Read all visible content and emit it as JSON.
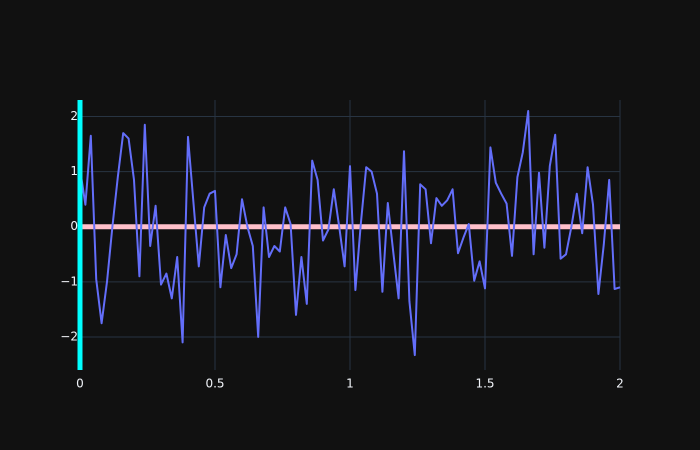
{
  "chart_data": {
    "type": "line",
    "title": "",
    "xlabel": "",
    "ylabel": "",
    "xlim": [
      0,
      2
    ],
    "ylim": [
      -2.6,
      2.3
    ],
    "grid": true,
    "x_ticks": [
      0,
      0.5,
      1,
      1.5,
      2
    ],
    "x_tick_labels": [
      "0",
      "0.5",
      "1",
      "1.5",
      "2"
    ],
    "y_ticks": [
      -2,
      -1,
      0,
      1,
      2
    ],
    "y_tick_labels": [
      "−2",
      "−1",
      "0",
      "1",
      "2"
    ],
    "series": [
      {
        "name": "",
        "color": "#636efa",
        "x": [
          0.0,
          0.02,
          0.04,
          0.06,
          0.08,
          0.1,
          0.12,
          0.14,
          0.16,
          0.18,
          0.2,
          0.22,
          0.24,
          0.26,
          0.28,
          0.3,
          0.32,
          0.34,
          0.36,
          0.38,
          0.4,
          0.42,
          0.44,
          0.46,
          0.48,
          0.5,
          0.52,
          0.54,
          0.56,
          0.58,
          0.6,
          0.62,
          0.64,
          0.66,
          0.68,
          0.7,
          0.72,
          0.74,
          0.76,
          0.78,
          0.8,
          0.82,
          0.84,
          0.86,
          0.88,
          0.9,
          0.92,
          0.94,
          0.96,
          0.98,
          1.0,
          1.02,
          1.04,
          1.06,
          1.08,
          1.1,
          1.12,
          1.14,
          1.16,
          1.18,
          1.2,
          1.22,
          1.24,
          1.26,
          1.28,
          1.3,
          1.32,
          1.34,
          1.36,
          1.38,
          1.4,
          1.42,
          1.44,
          1.46,
          1.48,
          1.5,
          1.52,
          1.54,
          1.56,
          1.58,
          1.6,
          1.62,
          1.64,
          1.66,
          1.68,
          1.7,
          1.72,
          1.74,
          1.76,
          1.78,
          1.8,
          1.82,
          1.84,
          1.86,
          1.88,
          1.9,
          1.92,
          1.94,
          1.96,
          1.98,
          2.0
        ],
        "y": [
          1.05,
          0.4,
          1.65,
          -0.95,
          -1.75,
          -1.0,
          0.0,
          0.9,
          1.7,
          1.6,
          0.85,
          -0.9,
          1.85,
          -0.35,
          0.38,
          -1.05,
          -0.85,
          -1.3,
          -0.55,
          -2.1,
          1.63,
          0.45,
          -0.72,
          0.35,
          0.6,
          0.65,
          -1.1,
          -0.15,
          -0.75,
          -0.5,
          0.5,
          0.0,
          -0.35,
          -2.0,
          0.35,
          -0.55,
          -0.35,
          -0.45,
          0.35,
          0.05,
          -1.6,
          -0.55,
          -1.4,
          1.2,
          0.85,
          -0.25,
          -0.05,
          0.68,
          0.0,
          -0.72,
          1.1,
          -1.15,
          0.05,
          1.08,
          1.0,
          0.6,
          -1.18,
          0.43,
          -0.45,
          -1.3,
          1.37,
          -1.35,
          -2.33,
          0.77,
          0.68,
          -0.3,
          0.52,
          0.38,
          0.48,
          0.68,
          -0.48,
          -0.2,
          0.05,
          -0.98,
          -0.63,
          -1.12,
          1.44,
          0.8,
          0.6,
          0.42,
          -0.53,
          0.9,
          1.35,
          2.1,
          -0.5,
          0.98,
          -0.38,
          1.1,
          1.67,
          -0.58,
          -0.5,
          0.0,
          0.6,
          -0.12,
          1.08,
          0.4,
          -1.22,
          -0.32,
          0.85,
          -1.13,
          -1.1
        ]
      }
    ],
    "reference_lines": [
      {
        "orientation": "horizontal",
        "value": 0,
        "color": "#ffc0cb"
      },
      {
        "orientation": "vertical",
        "value": 0,
        "color": "#00ffff"
      }
    ],
    "colors": {
      "background": "#111111",
      "grid": "#283442",
      "tick_text": "#f2f5fa"
    }
  }
}
